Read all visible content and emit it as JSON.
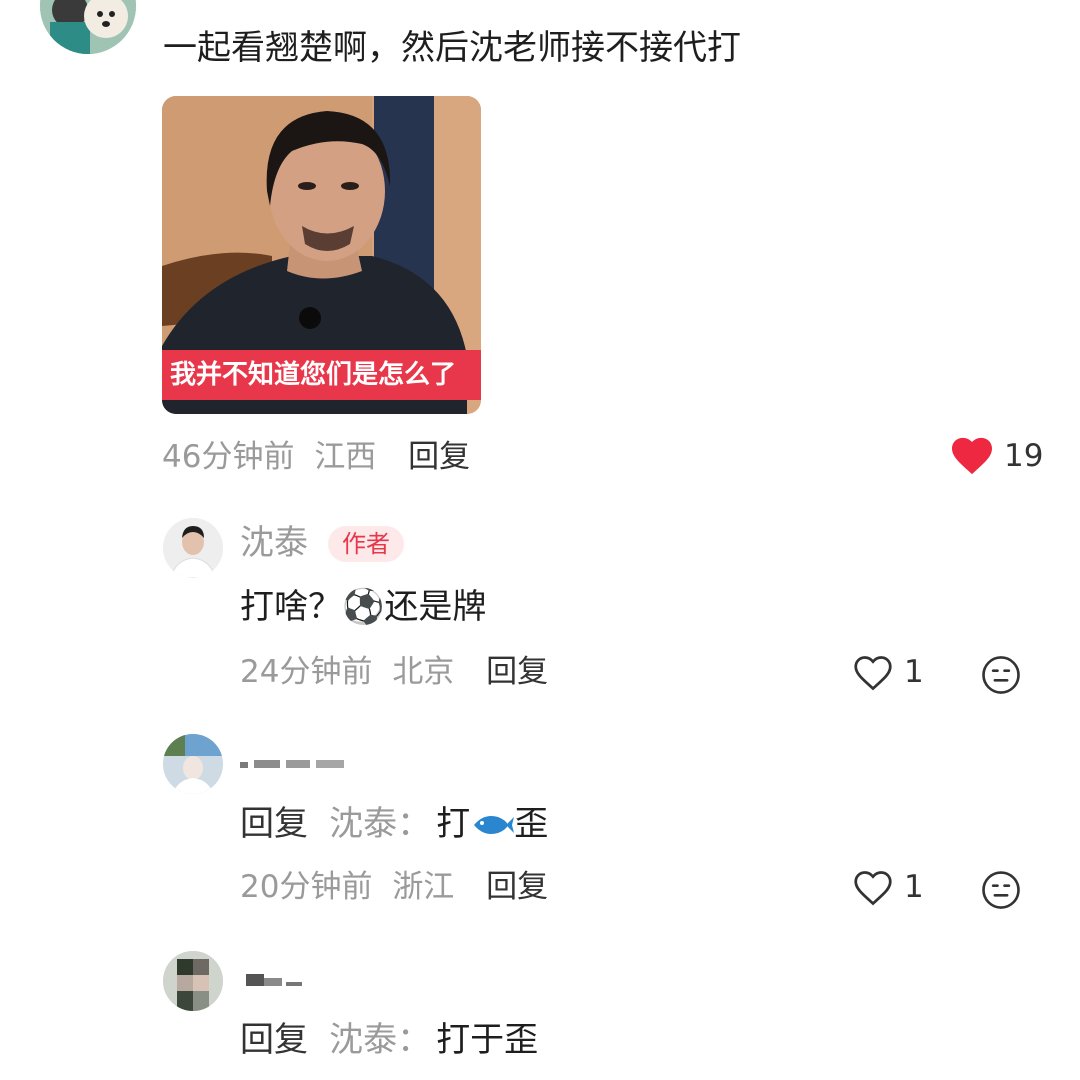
{
  "colors": {
    "accent_red": "#ee2840",
    "badge_bg": "#fde8ea",
    "muted_text": "#9a9a9a",
    "caption_bg": "#e8374a"
  },
  "top_comment": {
    "text": "一起看翘楚啊，然后沈老师接不接代打",
    "image": {
      "caption": "我并不知道您们是怎么了"
    },
    "time": "46分钟前",
    "location": "江西",
    "reply_label": "回复",
    "like_icon": "heart-filled-icon",
    "like_count": "19"
  },
  "replies": [
    {
      "username": "沈泰",
      "badge": "作者",
      "text": "打啥？⚽还是牌",
      "time": "24分钟前",
      "location": "北京",
      "reply_label": "回复",
      "like_icon": "heart-outline-icon",
      "like_count": "1",
      "react_icon": "neutral-face-icon"
    },
    {
      "username": "",
      "reply_prefix": "回复",
      "reply_target": "沈泰：",
      "text_before": "打",
      "emoji": "fish-icon",
      "text_after": "歪",
      "time": "20分钟前",
      "location": "浙江",
      "reply_label": "回复",
      "like_icon": "heart-outline-icon",
      "like_count": "1",
      "react_icon": "neutral-face-icon"
    },
    {
      "username": "",
      "reply_prefix": "回复",
      "reply_target": "沈泰：",
      "text": "打于歪"
    }
  ]
}
